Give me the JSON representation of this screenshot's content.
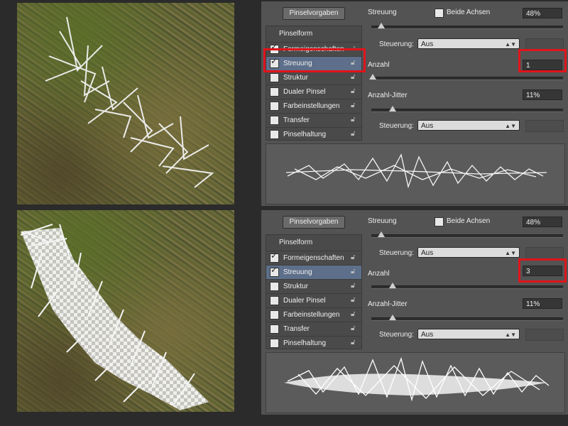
{
  "top": {
    "preset_button": "Pinselvorgaben",
    "list_title": "Pinselform",
    "items": [
      {
        "label": "Formeigenschaften",
        "checked": true,
        "selected": false
      },
      {
        "label": "Streuung",
        "checked": true,
        "selected": true
      },
      {
        "label": "Struktur",
        "checked": false,
        "selected": false
      },
      {
        "label": "Dualer Pinsel",
        "checked": false,
        "selected": false
      },
      {
        "label": "Farbeinstellungen",
        "checked": false,
        "selected": false
      },
      {
        "label": "Transfer",
        "checked": false,
        "selected": false
      },
      {
        "label": "Pinselhaltung",
        "checked": false,
        "selected": false
      }
    ],
    "streuung_label": "Streuung",
    "beide_achsen_label": "Beide Achsen",
    "streuung_value": "48%",
    "steuerung_label": "Steuerung:",
    "steuerung_value": "Aus",
    "anzahl_label": "Anzahl",
    "anzahl_value": "1",
    "anzahl_jitter_label": "Anzahl-Jitter",
    "anzahl_jitter_value": "11%",
    "steuerung2_label": "Steuerung:",
    "steuerung2_value": "Aus"
  },
  "bottom": {
    "preset_button": "Pinselvorgaben",
    "list_title": "Pinselform",
    "items": [
      {
        "label": "Formeigenschaften",
        "checked": true,
        "selected": false
      },
      {
        "label": "Streuung",
        "checked": true,
        "selected": true
      },
      {
        "label": "Struktur",
        "checked": false,
        "selected": false
      },
      {
        "label": "Dualer Pinsel",
        "checked": false,
        "selected": false
      },
      {
        "label": "Farbeinstellungen",
        "checked": false,
        "selected": false
      },
      {
        "label": "Transfer",
        "checked": false,
        "selected": false
      },
      {
        "label": "Pinselhaltung",
        "checked": false,
        "selected": false
      }
    ],
    "streuung_label": "Streuung",
    "beide_achsen_label": "Beide Achsen",
    "streuung_value": "48%",
    "steuerung_label": "Steuerung:",
    "steuerung_value": "Aus",
    "anzahl_label": "Anzahl",
    "anzahl_value": "3",
    "anzahl_jitter_label": "Anzahl-Jitter",
    "anzahl_jitter_value": "11%",
    "steuerung2_label": "Steuerung:",
    "steuerung2_value": "Aus"
  },
  "colors": {
    "highlight": "#e0141b",
    "selected_row": "#5d6f8a",
    "panel_bg": "#535353"
  }
}
